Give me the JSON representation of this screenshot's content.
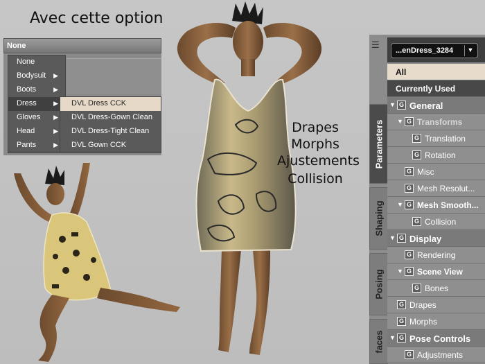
{
  "caption": "Avec cette option",
  "notes": [
    "Drapes",
    "Morphs",
    "Ajustements",
    "Collision"
  ],
  "menu": {
    "header": "None",
    "items": [
      {
        "label": "None",
        "has_sub": false
      },
      {
        "label": "Bodysuit",
        "has_sub": true
      },
      {
        "label": "Boots",
        "has_sub": true
      },
      {
        "label": "Dress",
        "has_sub": true
      },
      {
        "label": "Gloves",
        "has_sub": true
      },
      {
        "label": "Head",
        "has_sub": true
      },
      {
        "label": "Pants",
        "has_sub": true
      }
    ],
    "submenu": [
      "DVL Dress CCK",
      "DVL Dress-Gown Clean",
      "DVL Dress-Tight Clean",
      "DVL Gown CCK"
    ]
  },
  "panel": {
    "dropdown": "...enDress_3284",
    "tabs": [
      "Parameters",
      "Shaping",
      "Posing",
      "faces"
    ],
    "all": "All",
    "currently_used": "Currently Used",
    "tree": [
      {
        "label": "General",
        "kind": "group",
        "indent": 0,
        "tri": true
      },
      {
        "label": "Transforms",
        "kind": "sub",
        "indent": 1,
        "tri": true,
        "dim": true
      },
      {
        "label": "Translation",
        "kind": "item",
        "indent": 2,
        "tri": false
      },
      {
        "label": "Rotation",
        "kind": "item",
        "indent": 2,
        "tri": false
      },
      {
        "label": "Misc",
        "kind": "item",
        "indent": 1,
        "tri": false
      },
      {
        "label": "Mesh Resolut...",
        "kind": "item",
        "indent": 1,
        "tri": false
      },
      {
        "label": "Mesh Smooth...",
        "kind": "sub",
        "indent": 1,
        "tri": true
      },
      {
        "label": "Collision",
        "kind": "item",
        "indent": 2,
        "tri": false
      },
      {
        "label": "Display",
        "kind": "group",
        "indent": 0,
        "tri": true
      },
      {
        "label": "Rendering",
        "kind": "item",
        "indent": 1,
        "tri": false
      },
      {
        "label": "Scene View",
        "kind": "sub",
        "indent": 1,
        "tri": true
      },
      {
        "label": "Bones",
        "kind": "item",
        "indent": 2,
        "tri": false
      },
      {
        "label": "Drapes",
        "kind": "item",
        "indent": 0,
        "tri": false
      },
      {
        "label": "Morphs",
        "kind": "item",
        "indent": 0,
        "tri": false
      },
      {
        "label": "Pose Controls",
        "kind": "group",
        "indent": 0,
        "tri": true
      },
      {
        "label": "Adjustments",
        "kind": "item",
        "indent": 1,
        "tri": false
      }
    ]
  }
}
